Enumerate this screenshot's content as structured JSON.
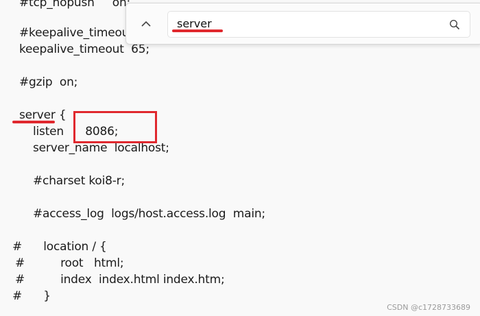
{
  "editor": {
    "lines": [
      "#tcp_nopush     on;",
      "#keepalive_timeout",
      "keepalive_timeout  65;",
      "#gzip  on;",
      "server {",
      "listen      8086;",
      "server_name  localhost;",
      "#charset koi8-r;",
      "#access_log  logs/host.access.log  main;",
      "#      location / {",
      "#          root   html;",
      "#          index  index.html index.htm;",
      "#      }"
    ]
  },
  "find": {
    "query": "server",
    "icons": {
      "previous": "chevron-up-icon",
      "search": "search-icon"
    }
  },
  "annotations": {
    "color": "#e0282e"
  },
  "watermark": "CSDN @c1728733689"
}
